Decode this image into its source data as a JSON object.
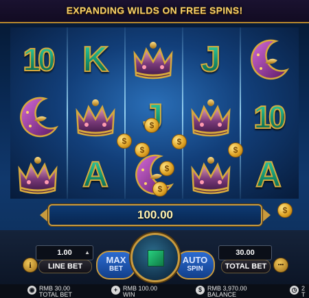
{
  "banner": {
    "text": "EXPANDING WILDS ON FREE SPINS!"
  },
  "reels": {
    "columns": [
      [
        "10",
        "moon",
        "crown"
      ],
      [
        "K",
        "crown",
        "A"
      ],
      [
        "crown",
        "J",
        "moon"
      ],
      [
        "J",
        "crown",
        "crown"
      ],
      [
        "moon",
        "10",
        "A"
      ]
    ]
  },
  "win": {
    "amount": "100.00"
  },
  "coins": {
    "symbol": "$"
  },
  "controls": {
    "info_icon": "i",
    "line_bet_value": "1.00",
    "line_bet_label": "LINE BET",
    "max_bet_line1": "MAX",
    "max_bet_line2": "BET",
    "auto_spin_line1": "AUTO",
    "auto_spin_line2": "SPIN",
    "total_bet_value": "30.00",
    "total_bet_label": "TOTAL BET",
    "menu_icon": "•••",
    "line_bet_stepper": "▲"
  },
  "footer": {
    "total_bet_value": "RMB 30.00",
    "total_bet_label": "TOTAL BET",
    "win_value": "RMB 100.00",
    "win_label": "WIN",
    "balance_value": "RMB 3,970.00",
    "balance_label": "BALANCE",
    "time_value": "2",
    "time_label": "T"
  },
  "colors": {
    "gold": "#c89a3e",
    "letter_green": "#13916f",
    "banner_text": "#f6d36a"
  },
  "icons": [
    "info-icon",
    "menu-icon",
    "spin-icon",
    "chip-icon",
    "plus-icon",
    "dollar-icon",
    "clock-icon",
    "coin-icon",
    "moon-icon",
    "crown-icon"
  ]
}
